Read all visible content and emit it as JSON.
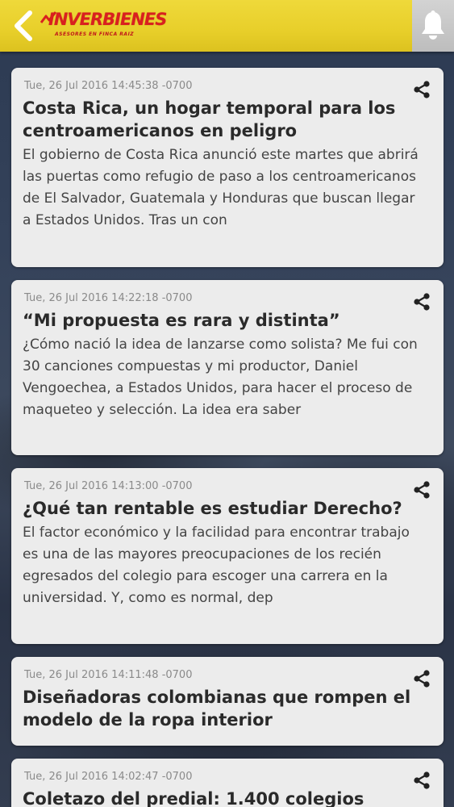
{
  "header": {
    "logo_name": "INVERBIENES",
    "logo_tagline": "ASESORES EN FINCA RAIZ",
    "brand_color": "#d9201f",
    "header_color": "#e8cf2a"
  },
  "icons": {
    "back": "chevron-left-icon",
    "notifications": "bell-icon",
    "share": "share-icon"
  },
  "articles": [
    {
      "date": "Tue, 26 Jul 2016 14:45:38 -0700",
      "title": "Costa Rica, un hogar temporal para los centroamericanos en peligro",
      "excerpt": "El gobierno de Costa Rica anunció este martes que abrirá las puertas como refugio de paso a los centroamericanos de El Salvador, Guatemala y Honduras que buscan llegar a Estados Unidos. Tras un con"
    },
    {
      "date": "Tue, 26 Jul 2016 14:22:18 -0700",
      "title": "“Mi propuesta es rara y distinta”",
      "excerpt": "¿Cómo nació la idea de lanzarse como solista? Me fui con 30 canciones compuestas y mi productor, Daniel Vengoechea, a Estados Unidos, para hacer el proceso de maqueteo y selección. La idea era saber"
    },
    {
      "date": "Tue, 26 Jul 2016 14:13:00 -0700",
      "title": "¿Qué tan rentable es estudiar Derecho?",
      "excerpt": "El factor económico y la facilidad para encontrar trabajo es una de las mayores preocupaciones de los recién egresados del colegio para escoger una carrera en la universidad. Y, como es normal, dep"
    },
    {
      "date": "Tue, 26 Jul 2016 14:11:48 -0700",
      "title": "Diseñadoras colombianas que rompen el modelo de la ropa interior",
      "excerpt": ""
    },
    {
      "date": "Tue, 26 Jul 2016 14:02:47 -0700",
      "title": "Coletazo del predial: 1.400 colegios",
      "excerpt": ""
    }
  ]
}
